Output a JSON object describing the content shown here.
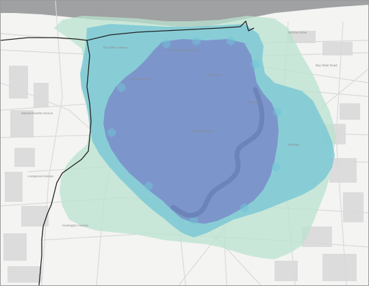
{
  "map": {
    "base_colors": {
      "land": "#f4f4f3",
      "water": "#9fa1a3",
      "road": "#ffffff",
      "road_casing": "#d9d9d9",
      "building": "#dcdcdc",
      "river": "#6c84b8"
    },
    "boundary": {
      "color": "#1f1f1f"
    },
    "coverage_zones": [
      {
        "level": "outer",
        "color": "#b9e3cf",
        "opacity": 0.75
      },
      {
        "level": "middle",
        "color": "#6fc4d6",
        "opacity": 0.72
      },
      {
        "level": "inner",
        "color": "#7a8cc9",
        "opacity": 0.85
      }
    ],
    "street_labels": [
      "Commonwealth Avenue",
      "Beacon Street",
      "Riverway",
      "Boylston Street",
      "Longwood Avenue",
      "Brookline Avenue",
      "Park Drive",
      "Fenway",
      "Huntington Avenue",
      "Storrow Drive",
      "Bay State Road",
      "Massachusetts Avenue"
    ]
  }
}
